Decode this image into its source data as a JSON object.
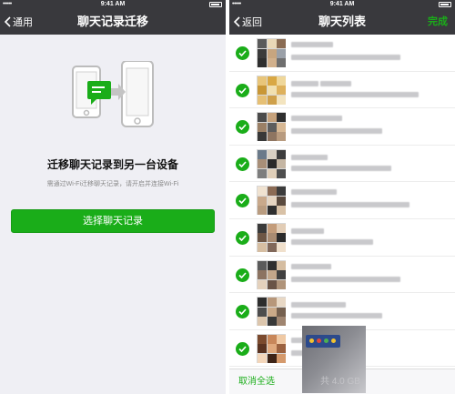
{
  "left_screen": {
    "status": {
      "signal": "•••••",
      "wifi_icon": "wifi-icon",
      "time": "9:41 AM"
    },
    "nav": {
      "back_label": "通用",
      "title": "聊天记录迁移"
    },
    "illustration": {
      "icon": "phone-transfer-icon",
      "accent": "#1aad19"
    },
    "headline": "迁移聊天记录到另一台设备",
    "subtext": "需通过Wi-Fi迁移聊天记录，请开启并连接Wi-Fi",
    "primary_button": "选择聊天记录"
  },
  "right_screen": {
    "status": {
      "signal": "•••••",
      "wifi_icon": "wifi-icon",
      "time": "9:41 AM"
    },
    "nav": {
      "back_label": "返回",
      "title": "聊天列表",
      "done_label": "完成"
    },
    "rows": [
      {
        "checked": true,
        "avatar_palette": [
          "#5a5a5a",
          "#e9d7b6",
          "#8a6b52",
          "#3b3b3b",
          "#c7a57f",
          "#9aa0a8",
          "#2e2e2e",
          "#d1b08c",
          "#6f6f6f"
        ]
      },
      {
        "checked": true,
        "avatar_palette": [
          "#e8c57a",
          "#d9a844",
          "#efd79a",
          "#c99736",
          "#f1e0b0",
          "#deb15c",
          "#e6c075",
          "#cfa04a",
          "#f3e4bf"
        ]
      },
      {
        "checked": true,
        "avatar_palette": [
          "#4b4b4b",
          "#c6a27c",
          "#2f2f2f",
          "#9b8066",
          "#5d5d5d",
          "#d7b894",
          "#383838",
          "#8e7561",
          "#b89b7f"
        ]
      },
      {
        "checked": true,
        "avatar_palette": [
          "#6b7a8a",
          "#d9d0c3",
          "#3d3d3d",
          "#a88f78",
          "#2a2a2a",
          "#c5b6a3",
          "#7d7d7d",
          "#e0cfb9",
          "#4f4f4f"
        ]
      },
      {
        "checked": true,
        "avatar_palette": [
          "#f0e2d0",
          "#8b6b55",
          "#3c3c3c",
          "#c9a98b",
          "#e6d5c1",
          "#5a4a3e",
          "#b99c80",
          "#2f2f2f",
          "#d8c1a6"
        ]
      },
      {
        "checked": true,
        "avatar_palette": [
          "#3a3a3a",
          "#c39c7a",
          "#e2cdb6",
          "#6d5645",
          "#a98b71",
          "#2b2b2b",
          "#d6bea2",
          "#81685a",
          "#f0e0cc"
        ]
      },
      {
        "checked": true,
        "avatar_palette": [
          "#5b5b5b",
          "#2f2f2f",
          "#d5bda1",
          "#8c7361",
          "#c2a68a",
          "#404040",
          "#e4d1bc",
          "#6a5446",
          "#b0947a"
        ]
      },
      {
        "checked": true,
        "avatar_palette": [
          "#2d2d2d",
          "#b7977a",
          "#e8d8c5",
          "#4d4d4d",
          "#caa988",
          "#75604f",
          "#dcc6ad",
          "#383838",
          "#9f8570"
        ]
      },
      {
        "checked": true,
        "avatar_palette": [
          "#7b4a2e",
          "#c8875a",
          "#efc9a4",
          "#5a3321",
          "#e0a97d",
          "#9b6240",
          "#f3d6ba",
          "#3e2417",
          "#d59a6c"
        ]
      },
      {
        "checked": false,
        "avatar_palette": [
          "#8a8a8a",
          "#d0c2b0",
          "#5a5a5a",
          "#b9a48f",
          "#6e6e6e",
          "#e0d4c6",
          "#4a4a4a",
          "#c7b39e",
          "#9a9a9a"
        ]
      }
    ],
    "bottom_bar": {
      "cancel_label": "取消全选",
      "size_label": "共 4.0 GB"
    }
  }
}
